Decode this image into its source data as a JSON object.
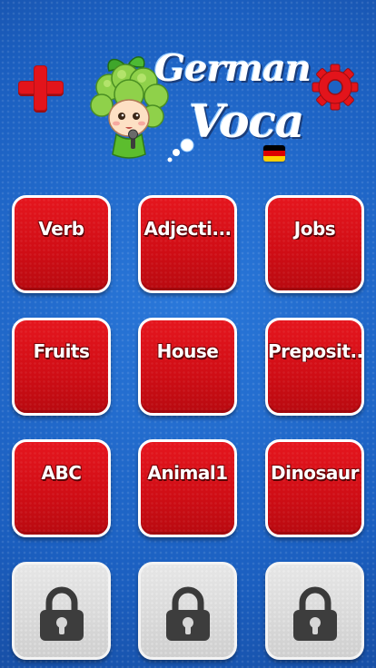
{
  "header": {
    "logo_line1": "German",
    "logo_line2": "Voca",
    "add_icon": "plus-icon",
    "settings_icon": "gear-icon",
    "flag": "german-flag",
    "flag_colors": [
      "#000000",
      "#dd0000",
      "#ffce00"
    ]
  },
  "categories": [
    {
      "label": "Verb"
    },
    {
      "label": "Adjecti..."
    },
    {
      "label": "Jobs"
    },
    {
      "label": "Fruits"
    },
    {
      "label": "House"
    },
    {
      "label": "Preposit..."
    },
    {
      "label": "ABC"
    },
    {
      "label": "Animal1"
    },
    {
      "label": "Dinosaur"
    }
  ],
  "locked_tiles": [
    {
      "icon": "lock-icon"
    },
    {
      "icon": "lock-icon"
    },
    {
      "icon": "lock-icon"
    }
  ],
  "colors": {
    "background": "#1d63c4",
    "tile_red": "#d8111a",
    "tile_locked": "#d8d8d8",
    "accent_red": "#e3141b"
  }
}
